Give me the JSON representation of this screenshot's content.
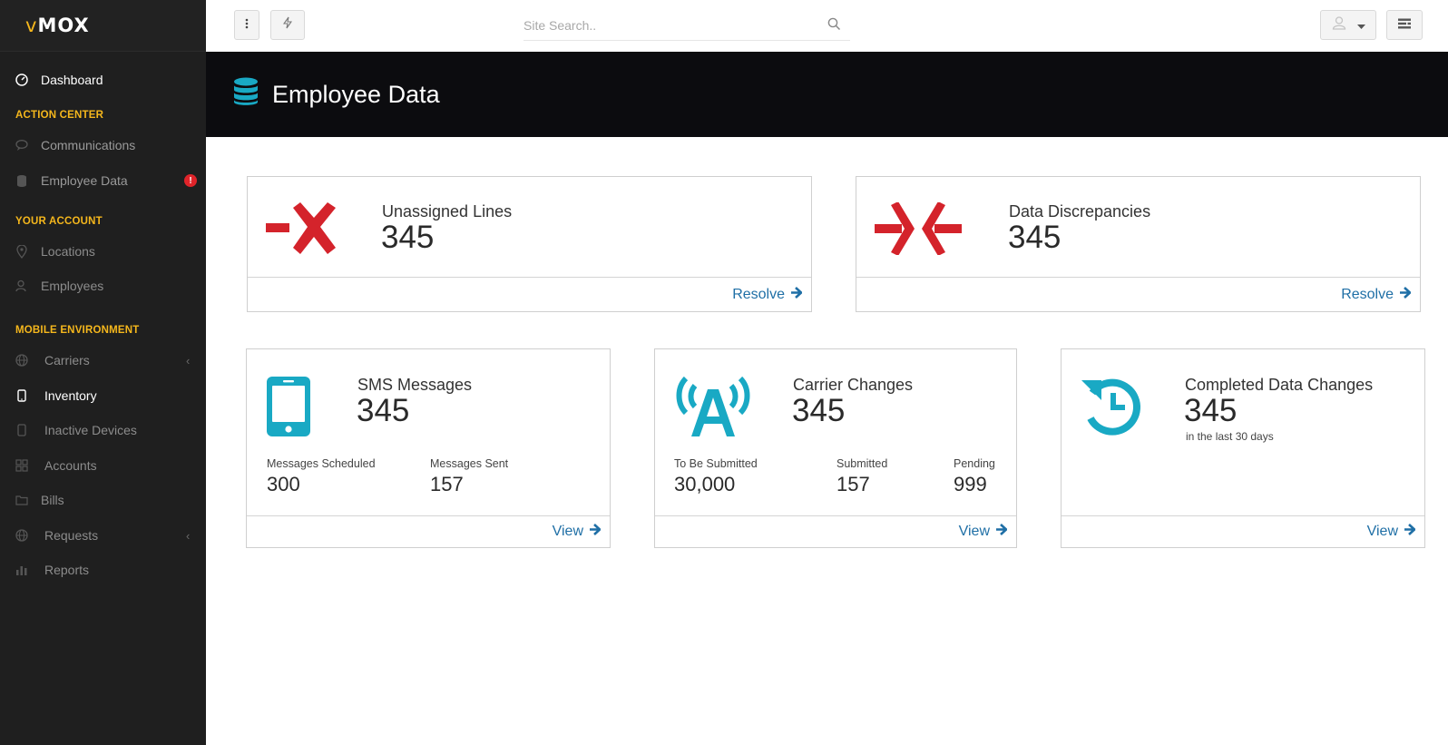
{
  "app": {
    "logo_prefix": "v",
    "logo_text": "MOX"
  },
  "sidebar": {
    "items": [
      {
        "label": "Dashboard"
      },
      {
        "label": "Communications"
      },
      {
        "label": "Employee Data",
        "badge": "!"
      },
      {
        "label": "Locations"
      },
      {
        "label": "Employees"
      },
      {
        "label": "Carriers"
      },
      {
        "label": "Inventory"
      },
      {
        "label": "Inactive Devices"
      },
      {
        "label": "Accounts"
      },
      {
        "label": "Bills"
      },
      {
        "label": "Requests"
      },
      {
        "label": "Reports"
      }
    ],
    "sections": {
      "action_center": "ACTION CENTER",
      "your_account": "YOUR ACCOUNT",
      "mobile_environment": "MOBILE ENVIRONMENT"
    }
  },
  "topbar": {
    "search_placeholder": "Site Search.."
  },
  "page": {
    "title": "Employee Data"
  },
  "cards": {
    "unassigned": {
      "title": "Unassigned Lines",
      "value": "345",
      "link": "Resolve"
    },
    "discrepancies": {
      "title": "Data Discrepancies",
      "value": "345",
      "link": "Resolve"
    },
    "sms": {
      "title": "SMS Messages",
      "value": "345",
      "link": "View",
      "stats": [
        {
          "label": "Messages Scheduled",
          "value": "300"
        },
        {
          "label": "Messages Sent",
          "value": "157"
        }
      ]
    },
    "carrier": {
      "title": "Carrier Changes",
      "value": "345",
      "link": "View",
      "stats": [
        {
          "label": "To Be Submitted",
          "value": "30,000"
        },
        {
          "label": "Submitted",
          "value": "157"
        },
        {
          "label": "Pending",
          "value": "999"
        }
      ]
    },
    "completed": {
      "title": "Completed Data Changes",
      "value": "345",
      "sub": "in the last 30 days",
      "link": "View"
    }
  },
  "colors": {
    "accent": "#f5b71c",
    "danger": "#d4232b",
    "teal": "#19a9c4",
    "link": "#1f6fa6",
    "sidebar_bg": "#1f1f1f",
    "banner_bg": "#0c0c0f"
  }
}
